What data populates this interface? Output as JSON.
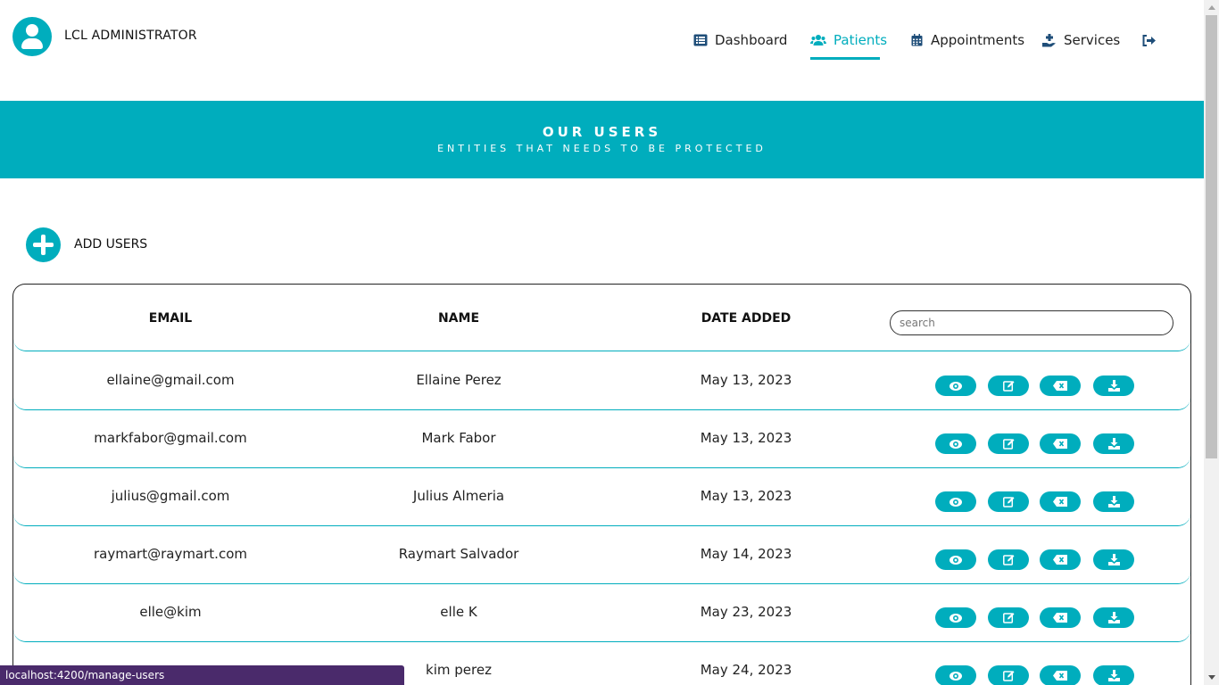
{
  "header": {
    "admin_name": "LCL ADMINISTRATOR"
  },
  "nav": {
    "items": [
      {
        "label": "Dashboard",
        "icon": "list-icon",
        "active": false
      },
      {
        "label": "Patients",
        "icon": "users-icon",
        "active": true
      },
      {
        "label": "Appointments",
        "icon": "calendar-icon",
        "active": false
      },
      {
        "label": "Services",
        "icon": "hand-holding-medical-icon",
        "active": false
      }
    ],
    "logout_icon": "sign-out-icon"
  },
  "banner": {
    "title": "OUR USERS",
    "subtitle": "ENTITIES THAT NEEDS TO BE PROTECTED"
  },
  "add_users": {
    "label": "ADD USERS",
    "icon": "plus-circle-icon"
  },
  "table": {
    "columns": [
      "EMAIL",
      "NAME",
      "DATE ADDED"
    ],
    "search_placeholder": "search",
    "rows": [
      {
        "email": "ellaine@gmail.com",
        "name": "Ellaine Perez",
        "date": "May 13, 2023"
      },
      {
        "email": "markfabor@gmail.com",
        "name": "Mark Fabor",
        "date": "May 13, 2023"
      },
      {
        "email": "julius@gmail.com",
        "name": "Julius Almeria",
        "date": "May 13, 2023"
      },
      {
        "email": "raymart@raymart.com",
        "name": "Raymart Salvador",
        "date": "May 14, 2023"
      },
      {
        "email": "elle@kim",
        "name": "elle K",
        "date": "May 23, 2023"
      },
      {
        "email": "",
        "name": "kim perez",
        "date": "May 24, 2023"
      }
    ],
    "row_actions": [
      "view-icon",
      "edit-icon",
      "delete-icon",
      "download-icon"
    ]
  },
  "status_bar": {
    "url": "localhost:4200/manage-users"
  },
  "colors": {
    "accent": "#00adbd",
    "status_bar": "#4a2a6b"
  }
}
